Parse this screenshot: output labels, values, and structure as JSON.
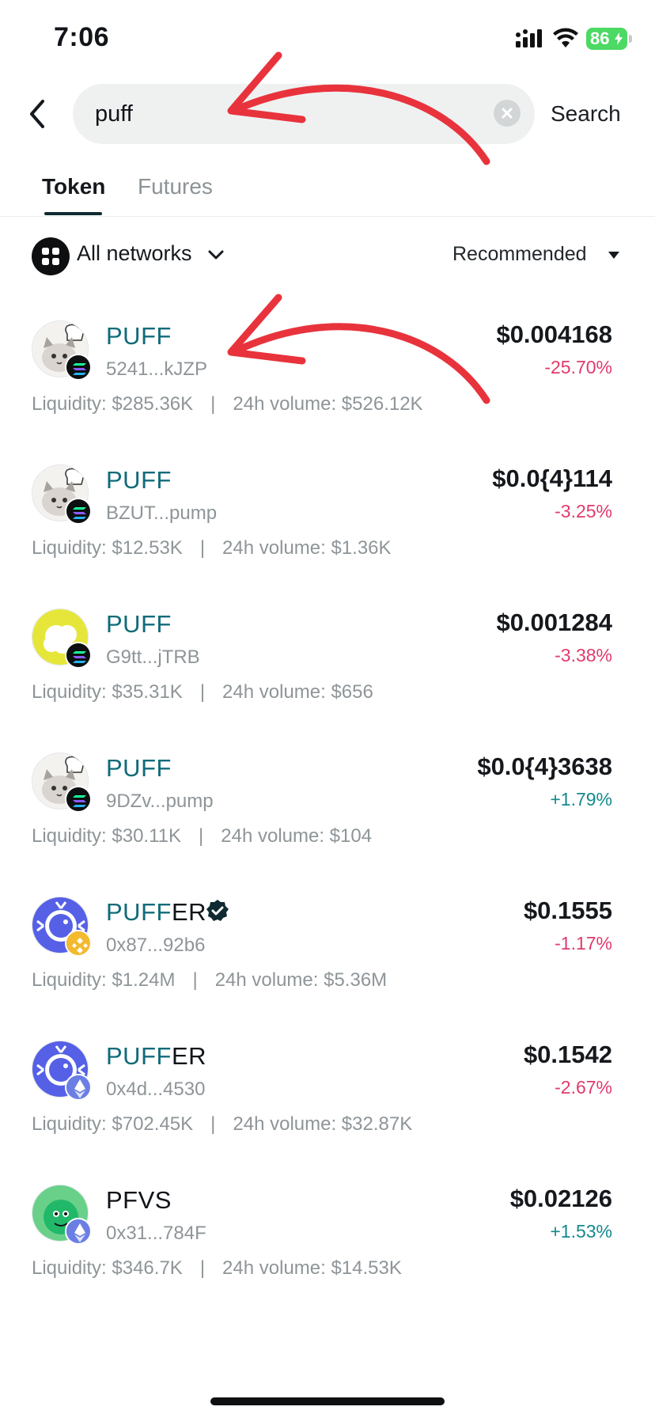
{
  "status_bar": {
    "time": "7:06",
    "battery": "86",
    "icons": [
      "signal-icon",
      "wifi-icon",
      "battery-icon"
    ]
  },
  "search": {
    "value": "puff",
    "button_label": "Search",
    "icons": [
      "back-chevron-icon",
      "clear-icon"
    ]
  },
  "tabs": [
    {
      "label": "Token",
      "active": true
    },
    {
      "label": "Futures",
      "active": false
    }
  ],
  "filters": {
    "network_label": "All networks",
    "sort_label": "Recommended",
    "icons": [
      "grid-icon",
      "chevron-down-icon",
      "caret-down-icon"
    ]
  },
  "tokens": [
    {
      "symbol_match": "PUFF",
      "symbol_rest": "",
      "verified": false,
      "address": "5241...kJZP",
      "chain": "solana",
      "price": "$0.004168",
      "change": "-25.70%",
      "change_dir": "neg",
      "liquidity": "Liquidity: $285.36K",
      "volume": "24h volume: $526.12K",
      "avatar": "cat-chef-icon"
    },
    {
      "symbol_match": "PUFF",
      "symbol_rest": "",
      "verified": false,
      "address": "BZUT...pump",
      "chain": "solana",
      "price": "$0.0{4}114",
      "change": "-3.25%",
      "change_dir": "neg",
      "liquidity": "Liquidity: $12.53K",
      "volume": "24h volume: $1.36K",
      "avatar": "cat-chef-icon"
    },
    {
      "symbol_match": "PUFF",
      "symbol_rest": "",
      "verified": false,
      "address": "G9tt...jTRB",
      "chain": "solana",
      "price": "$0.001284",
      "change": "-3.38%",
      "change_dir": "neg",
      "liquidity": "Liquidity: $35.31K",
      "volume": "24h volume: $656",
      "avatar": "cloud-icon"
    },
    {
      "symbol_match": "PUFF",
      "symbol_rest": "",
      "verified": false,
      "address": "9DZv...pump",
      "chain": "solana",
      "price": "$0.0{4}3638",
      "change": "+1.79%",
      "change_dir": "pos",
      "liquidity": "Liquidity: $30.11K",
      "volume": "24h volume: $104",
      "avatar": "cat-chef-icon"
    },
    {
      "symbol_match": "PUFF",
      "symbol_rest": "ER",
      "verified": true,
      "address": "0x87...92b6",
      "chain": "bnb",
      "price": "$0.1555",
      "change": "-1.17%",
      "change_dir": "neg",
      "liquidity": "Liquidity: $1.24M",
      "volume": "24h volume: $5.36M",
      "avatar": "pufferfish-icon"
    },
    {
      "symbol_match": "PUFF",
      "symbol_rest": "ER",
      "verified": false,
      "address": "0x4d...4530",
      "chain": "ethereum",
      "price": "$0.1542",
      "change": "-2.67%",
      "change_dir": "neg",
      "liquidity": "Liquidity: $702.45K",
      "volume": "24h volume: $32.87K",
      "avatar": "pufferfish-icon"
    },
    {
      "symbol_match": "",
      "symbol_rest": "PFVS",
      "verified": false,
      "address": "0x31...784F",
      "chain": "ethereum",
      "price": "$0.02126",
      "change": "+1.53%",
      "change_dir": "pos",
      "liquidity": "Liquidity: $346.7K",
      "volume": "24h volume: $14.53K",
      "avatar": "green-monster-icon"
    }
  ],
  "colors": {
    "accent": "#106b7a",
    "negative": "#e23a6d",
    "positive": "#138a8c",
    "annotation_arrow": "#e8333c",
    "battery": "#4cd964"
  }
}
